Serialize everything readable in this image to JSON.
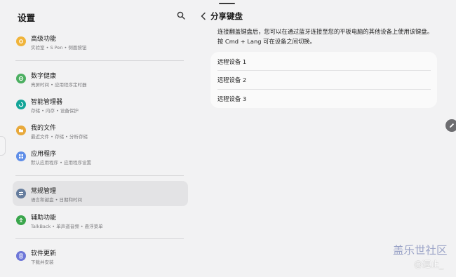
{
  "sidebar": {
    "title": "设置",
    "items": [
      {
        "label": "高级功能",
        "sub": "实验室 • S Pen • 侧面按钮",
        "icon": "star-gear-icon",
        "color": "#f0b43a"
      },
      {
        "label": "数字健康",
        "sub": "亮屏时间 • 应用程序定时器",
        "icon": "wellbeing-icon",
        "color": "#4caf61"
      },
      {
        "label": "智能管理器",
        "sub": "存储 • 内存 • 设备保护",
        "icon": "device-care-icon",
        "color": "#13a598"
      },
      {
        "label": "我的文件",
        "sub": "最近文件 • 存储 • 分析存储",
        "icon": "folder-icon",
        "color": "#e8a93b"
      },
      {
        "label": "应用程序",
        "sub": "默认应用程序 • 应用程序设置",
        "icon": "apps-grid-icon",
        "color": "#5f8ee8"
      },
      {
        "label": "常规管理",
        "sub": "语言和键盘 • 日期和时间",
        "icon": "sliders-icon",
        "color": "#667d9e"
      },
      {
        "label": "辅助功能",
        "sub": "TalkBack • 单声道音频 • 悬浮菜单",
        "icon": "accessibility-icon",
        "color": "#3aa64c"
      },
      {
        "label": "软件更新",
        "sub": "下载并安装",
        "icon": "software-update-icon",
        "color": "#6e77d8"
      }
    ]
  },
  "detail": {
    "title": "分享键盘",
    "description": "连接翻盖键盘后，您可以在通过蓝牙连接至您的平板电脑的其他设备上使用该键盘。按 Cmd + Lang 可在设备之间切换。",
    "devices": [
      "远程设备 1",
      "远程设备 2",
      "远程设备 3"
    ]
  },
  "watermark": {
    "line1": "盖乐世社区",
    "line2": "@逗止_"
  }
}
